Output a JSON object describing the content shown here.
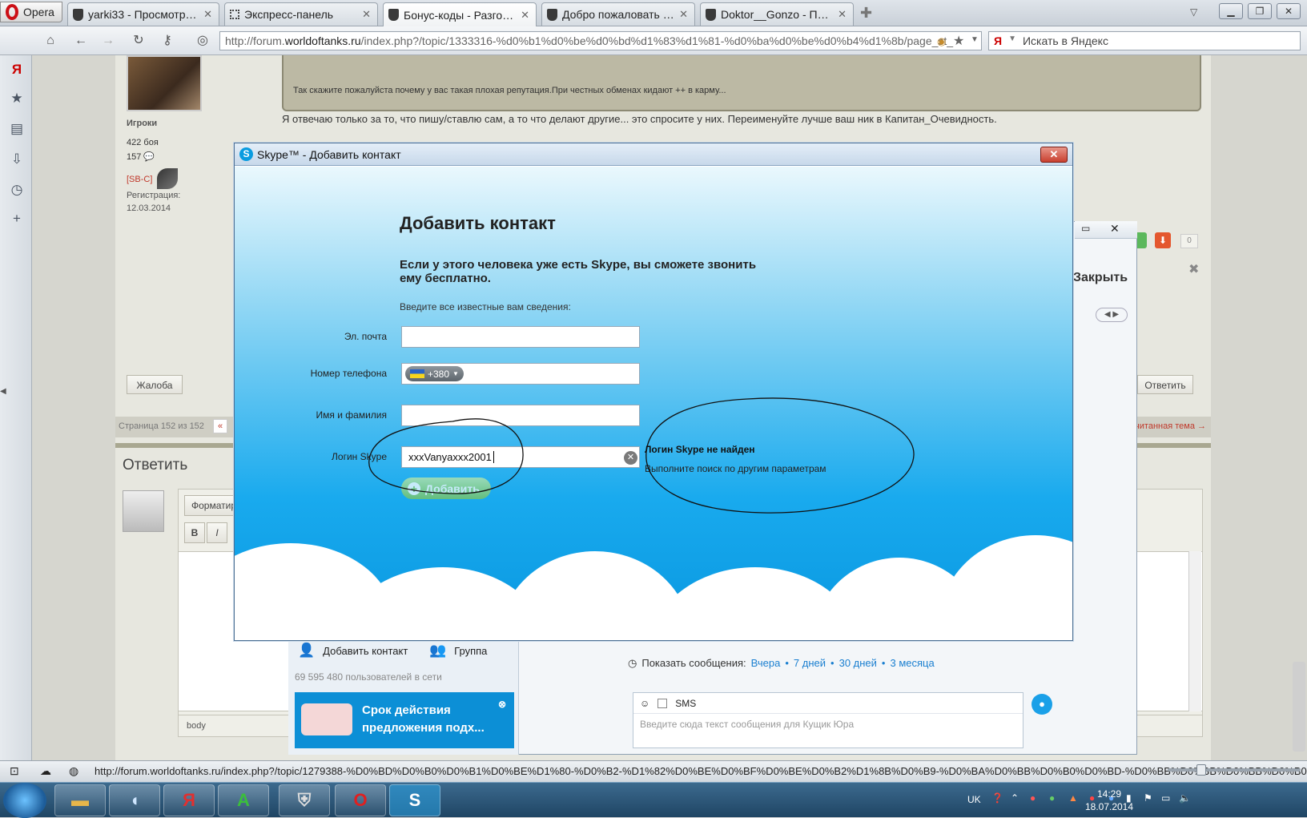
{
  "browser": {
    "menu_label": "Opera",
    "tabs": [
      {
        "title": "yarki33 - Просмотр пр...",
        "icon": "wot-icon"
      },
      {
        "title": "Экспресс-панель",
        "icon": "grid-icon"
      },
      {
        "title": "Бонус-коды - Разгово...",
        "icon": "wot-icon",
        "active": true
      },
      {
        "title": "Добро пожаловать в в...",
        "icon": "wot-icon"
      },
      {
        "title": "Doktor__Gonzo - Прос...",
        "icon": "wot-icon"
      }
    ],
    "url_prefix": "http://forum.",
    "url_domain": "worldoftanks.ru",
    "url_rest": "/index.php?/topic/1333316-%d0%b1%d0%be%d0%bd%d1%83%d1%81-%d0%ba%d0%be%d0%b4%d1%8b/page_st_",
    "search_placeholder": "Искать в Яндекс",
    "status_url": "http://forum.worldoftanks.ru/index.php?/topic/1279388-%D0%BD%D0%B0%D0%B1%D0%BE%D1%80-%D0%B2-%D1%82%D0%BE%D0%BF%D0%BE%D0%B2%D1%8B%D0%B9-%D0%BA%D0%BB%D0%B0%D0%BD-%D0%BB%D0%BB%D0%BB%D0%B0%D0%BB%D0%BD-s..."
  },
  "forum": {
    "quote_text": "Так скажите пожалуйста почему у вас такая плохая репутация.При честных обменах кидают ++ в карму...",
    "reply_text": "Я отвечаю только за то, что пишу/ставлю сам, а то что делают другие... это спросите у них. Переименуйте лучше ваш ник в Капитан_Очевидность.",
    "user_group": "Игроки",
    "battles": "422 боя",
    "posts": "157",
    "clan": "[SB-C]",
    "reg_label": "Регистрация:",
    "reg_date": "12.03.2014",
    "complain_btn": "Жалоба",
    "reply_btn": "Ответить",
    "pagination": "Страница 152 из 152",
    "pag_prev": "«",
    "unread_topic": "читанная тема →",
    "reply_section_title": "Ответить",
    "format_label": "Форматир",
    "bold_btn": "B",
    "italic_btn": "I",
    "body_tag": "body",
    "rating_count": "0"
  },
  "skype_main": {
    "close_label": "Закрыть",
    "add_contact": "Добавить контакт",
    "group": "Группа",
    "online_count": "69 595 480 пользователей в сети",
    "promo_line1": "Срок действия",
    "promo_line2": "предложения подх...",
    "show_messages": "Показать сообщения:",
    "periods": [
      "Вчера",
      "7 дней",
      "30 дней",
      "3 месяца"
    ],
    "sms_label": "SMS",
    "msg_placeholder": "Введите сюда текст сообщения для Кущик Юра"
  },
  "dialog": {
    "window_title": "Skype™ - Добавить контакт",
    "heading": "Добавить контакт",
    "subheading": "Если у этого человека уже есть Skype, вы сможете звонить ему бесплатно.",
    "hint": "Введите все известные вам сведения:",
    "email_label": "Эл. почта",
    "email_value": "",
    "phone_label": "Номер телефона",
    "phone_code": "+380",
    "name_label": "Имя и фамилия",
    "name_value": "",
    "login_label": "Логин Skype",
    "login_value": "xxxVanyaxxx2001",
    "add_button": "Добавить",
    "error_title": "Логин Skype не найден",
    "error_text": "Выполните поиск по другим параметрам"
  },
  "taskbar": {
    "lang": "UK",
    "time": "14:29",
    "date": "18.07.2014"
  }
}
